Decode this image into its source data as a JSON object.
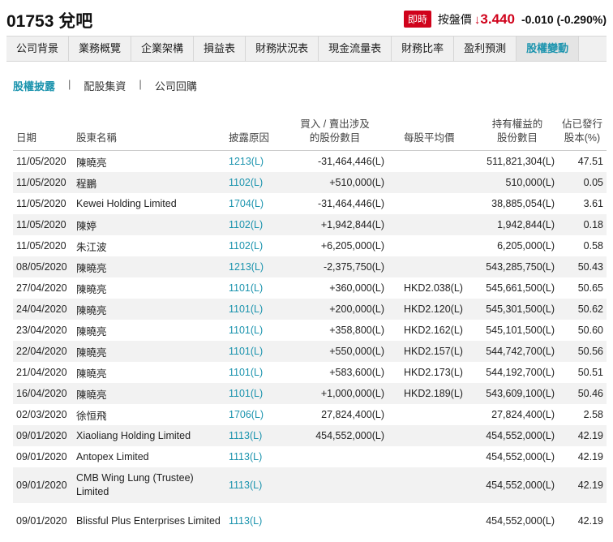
{
  "stock": {
    "code": "01753",
    "name": "兌吧"
  },
  "quote": {
    "live_badge": "即時",
    "label": "按盤價",
    "arrow": "↓",
    "price": "3.440",
    "change": "-0.010 (-0.290%)",
    "down_color": "#d0021b"
  },
  "tabs": [
    "公司背景",
    "業務概覽",
    "企業架構",
    "損益表",
    "財務狀況表",
    "現金流量表",
    "財務比率",
    "盈利預測",
    "股權變動"
  ],
  "active_tab": "股權變動",
  "subnav": [
    "股權披露",
    "配股集資",
    "公司回購"
  ],
  "table": {
    "headers": {
      "date": "日期",
      "holder": "股東名稱",
      "reason": "披露原因",
      "shares_line1": "買入 / 賣出涉及",
      "shares_line2": "的股份數目",
      "avg": "每股平均價",
      "held_line1": "持有權益的",
      "held_line2": "股份數目",
      "pct_line1": "佔已發行",
      "pct_line2": "股本(%)"
    },
    "rows": [
      {
        "date": "11/05/2020",
        "holder": "陳曉亮",
        "reason": "1213(L)",
        "shares": "-31,464,446(L)",
        "avg": "",
        "held": "511,821,304(L)",
        "pct": "47.51"
      },
      {
        "date": "11/05/2020",
        "holder": "程鵬",
        "reason": "1102(L)",
        "shares": "+510,000(L)",
        "avg": "",
        "held": "510,000(L)",
        "pct": "0.05"
      },
      {
        "date": "11/05/2020",
        "holder": "Kewei Holding Limited",
        "reason": "1704(L)",
        "shares": "-31,464,446(L)",
        "avg": "",
        "held": "38,885,054(L)",
        "pct": "3.61"
      },
      {
        "date": "11/05/2020",
        "holder": "陳婷",
        "reason": "1102(L)",
        "shares": "+1,942,844(L)",
        "avg": "",
        "held": "1,942,844(L)",
        "pct": "0.18"
      },
      {
        "date": "11/05/2020",
        "holder": "朱江波",
        "reason": "1102(L)",
        "shares": "+6,205,000(L)",
        "avg": "",
        "held": "6,205,000(L)",
        "pct": "0.58"
      },
      {
        "date": "08/05/2020",
        "holder": "陳曉亮",
        "reason": "1213(L)",
        "shares": "-2,375,750(L)",
        "avg": "",
        "held": "543,285,750(L)",
        "pct": "50.43"
      },
      {
        "date": "27/04/2020",
        "holder": "陳曉亮",
        "reason": "1101(L)",
        "shares": "+360,000(L)",
        "avg": "HKD2.038(L)",
        "held": "545,661,500(L)",
        "pct": "50.65"
      },
      {
        "date": "24/04/2020",
        "holder": "陳曉亮",
        "reason": "1101(L)",
        "shares": "+200,000(L)",
        "avg": "HKD2.120(L)",
        "held": "545,301,500(L)",
        "pct": "50.62"
      },
      {
        "date": "23/04/2020",
        "holder": "陳曉亮",
        "reason": "1101(L)",
        "shares": "+358,800(L)",
        "avg": "HKD2.162(L)",
        "held": "545,101,500(L)",
        "pct": "50.60"
      },
      {
        "date": "22/04/2020",
        "holder": "陳曉亮",
        "reason": "1101(L)",
        "shares": "+550,000(L)",
        "avg": "HKD2.157(L)",
        "held": "544,742,700(L)",
        "pct": "50.56"
      },
      {
        "date": "21/04/2020",
        "holder": "陳曉亮",
        "reason": "1101(L)",
        "shares": "+583,600(L)",
        "avg": "HKD2.173(L)",
        "held": "544,192,700(L)",
        "pct": "50.51"
      },
      {
        "date": "16/04/2020",
        "holder": "陳曉亮",
        "reason": "1101(L)",
        "shares": "+1,000,000(L)",
        "avg": "HKD2.189(L)",
        "held": "543,609,100(L)",
        "pct": "50.46"
      },
      {
        "date": "02/03/2020",
        "holder": "徐恒飛",
        "reason": "1706(L)",
        "shares": "27,824,400(L)",
        "avg": "",
        "held": "27,824,400(L)",
        "pct": "2.58"
      },
      {
        "date": "09/01/2020",
        "holder": "Xiaoliang Holding Limited",
        "reason": "1113(L)",
        "shares": "454,552,000(L)",
        "avg": "",
        "held": "454,552,000(L)",
        "pct": "42.19"
      },
      {
        "date": "09/01/2020",
        "holder": "Antopex Limited",
        "reason": "1113(L)",
        "shares": "",
        "avg": "",
        "held": "454,552,000(L)",
        "pct": "42.19"
      },
      {
        "date": "09/01/2020",
        "holder": "CMB Wing Lung (Trustee) Limited",
        "reason": "1113(L)",
        "shares": "",
        "avg": "",
        "held": "454,552,000(L)",
        "pct": "42.19",
        "tall": true
      },
      {
        "date": "09/01/2020",
        "holder": "Blissful Plus Enterprises Limited",
        "reason": "1113(L)",
        "shares": "",
        "avg": "",
        "held": "454,552,000(L)",
        "pct": "42.19",
        "tall": true
      }
    ]
  }
}
